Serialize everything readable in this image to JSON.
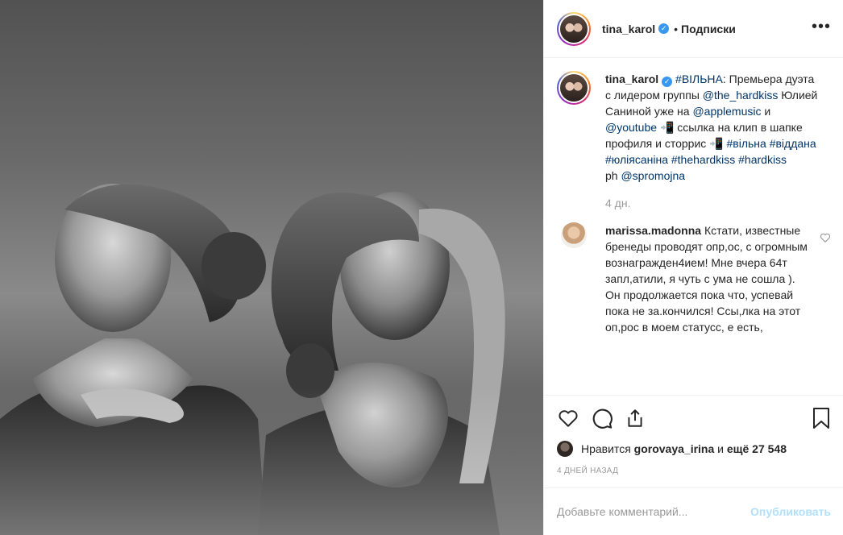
{
  "header": {
    "username": "tina_karol",
    "separator": "•",
    "follow_label": "Подписки",
    "more_label": "•••"
  },
  "caption": {
    "username": "tina_karol",
    "hashtag_main": "#ВІЛЬНА",
    "line1": ": Премьера дуэта с лидером группы ",
    "mention1": "@the_hardkiss",
    "line2": " Юлией Саниной уже на ",
    "mention2": "@applemusic",
    "line3": " и ",
    "mention3": "@youtube",
    "phone_emoji1": "📲",
    "line4": " ссылка на клип в шапке профиля и сторрис ",
    "phone_emoji2": "📲",
    "tags": "#вільна #віддана #юліясаніна #thehardkiss #hardkiss",
    "ph_label": "ph ",
    "mention4": "@spromojna",
    "time": "4 дн."
  },
  "comment": {
    "username": "marissa.madonna",
    "text": "Кстати, известные бренеды проводят опр,ос, с огромным вознагражден4ием! Мне вчера 64т запл,атили, я чуть с ума не сошла ). Он продолжается пока что, успевай пока не за.кончился! Ссы,лка на этот оп,рос в моем статусс, е есть,"
  },
  "likes": {
    "prefix": "Нравится",
    "user": "gorovaya_irina",
    "middle": "и",
    "count": "ещё 27 548"
  },
  "date": "4 дней назад",
  "add_comment": {
    "placeholder": "Добавьте комментарий...",
    "publish": "Опубликовать"
  },
  "colors": {
    "link": "#003569",
    "verified": "#3897f0",
    "publish_disabled": "#b2dffc"
  }
}
